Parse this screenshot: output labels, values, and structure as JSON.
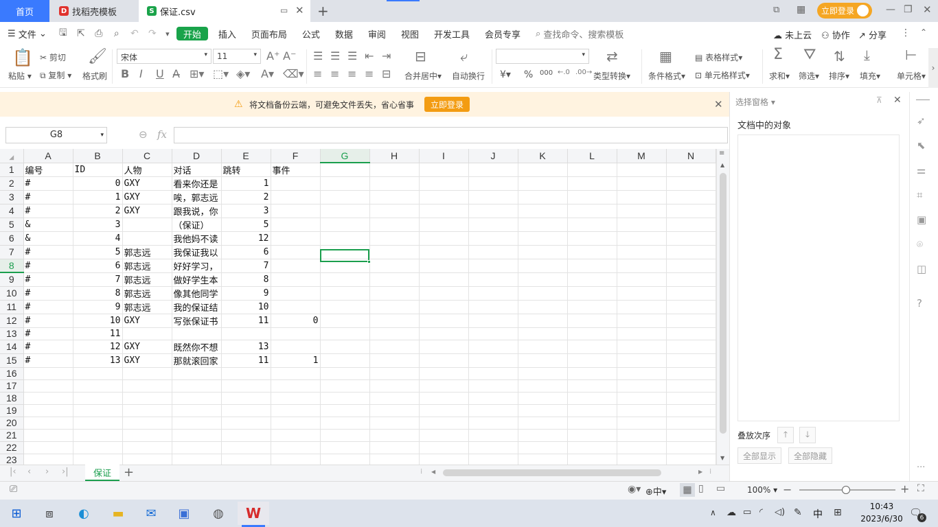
{
  "tabs": {
    "home": "首页",
    "template": "找稻壳模板",
    "file": "保证.csv",
    "login": "立即登录"
  },
  "menu": {
    "file": "文件",
    "start": "开始",
    "insert": "插入",
    "page_layout": "页面布局",
    "formula": "公式",
    "data": "数据",
    "review": "审阅",
    "view": "视图",
    "dev": "开发工具",
    "member": "会员专享",
    "search": "查找命令、搜索模板",
    "cloud": "未上云",
    "collab": "协作",
    "share": "分享"
  },
  "ribbon": {
    "paste": "粘贴",
    "cut": "剪切",
    "copy": "复制",
    "format_painter": "格式刷",
    "font": "宋体",
    "size": "11",
    "merge": "合并居中",
    "wrap": "自动换行",
    "type_convert": "类型转换",
    "cond_format": "条件格式",
    "table_style": "表格样式",
    "cell_style": "单元格样式",
    "sum": "求和",
    "filter": "筛选",
    "sort": "排序",
    "fill": "填充",
    "cell": "单元格",
    "yen": "¥",
    "percent": "%",
    "thousands": "000"
  },
  "notice": {
    "text": "将文档备份云端，可避免文件丢失，省心省事",
    "button": "立即登录"
  },
  "formula_bar": {
    "cell": "G8",
    "fx": "fx"
  },
  "grid": {
    "columns": [
      "A",
      "B",
      "C",
      "D",
      "E",
      "F",
      "G",
      "H",
      "I",
      "J",
      "K",
      "L",
      "M",
      "N"
    ],
    "rows": [
      [
        "编号",
        "ID",
        "人物",
        "对话",
        "跳转",
        "事件"
      ],
      [
        "#",
        "0",
        "GXY",
        "看来你还是",
        "1",
        ""
      ],
      [
        "#",
        "1",
        "GXY",
        "唉，郭志远",
        "2",
        ""
      ],
      [
        "#",
        "2",
        "GXY",
        "跟我说，你",
        "3",
        ""
      ],
      [
        "&",
        "3",
        "",
        "（保证）",
        "5",
        ""
      ],
      [
        "&",
        "4",
        "",
        "我他妈不读",
        "12",
        ""
      ],
      [
        "#",
        "5",
        "郭志远",
        "我保证我以",
        "6",
        ""
      ],
      [
        "#",
        "6",
        "郭志远",
        "好好学习，",
        "7",
        ""
      ],
      [
        "#",
        "7",
        "郭志远",
        "做好学生本",
        "8",
        ""
      ],
      [
        "#",
        "8",
        "郭志远",
        "像其他同学",
        "9",
        ""
      ],
      [
        "#",
        "9",
        "郭志远",
        "我的保证结",
        "10",
        ""
      ],
      [
        "#",
        "10",
        "GXY",
        "写张保证书",
        "11",
        "0"
      ],
      [
        "#",
        "11",
        "",
        "",
        "",
        ""
      ],
      [
        "#",
        "12",
        "GXY",
        "既然你不想",
        "13",
        ""
      ],
      [
        "#",
        "13",
        "GXY",
        "那就滚回家",
        "11",
        "1"
      ],
      [
        "",
        "",
        "",
        "",
        "",
        ""
      ],
      [
        "",
        "",
        "",
        "",
        "",
        ""
      ],
      [
        "",
        "",
        "",
        "",
        "",
        ""
      ],
      [
        "",
        "",
        "",
        "",
        "",
        ""
      ],
      [
        "",
        "",
        "",
        "",
        "",
        ""
      ],
      [
        "",
        "",
        "",
        "",
        "",
        ""
      ],
      [
        "",
        "",
        "",
        "",
        "",
        ""
      ],
      [
        "",
        "",
        "",
        "",
        "",
        ""
      ],
      [
        "",
        "",
        "",
        "",
        "",
        ""
      ],
      [
        "",
        "",
        "",
        "",
        "",
        ""
      ]
    ]
  },
  "sheet": {
    "name": "保证"
  },
  "pane": {
    "title": "选择窗格",
    "objects": "文档中的对象",
    "order": "叠放次序",
    "show_all": "全部显示",
    "hide_all": "全部隐藏"
  },
  "status": {
    "zoom": "100%",
    "ime": "中"
  },
  "taskbar": {
    "time": "10:43",
    "date": "2023/6/30",
    "ime": "中",
    "notif": "6"
  }
}
